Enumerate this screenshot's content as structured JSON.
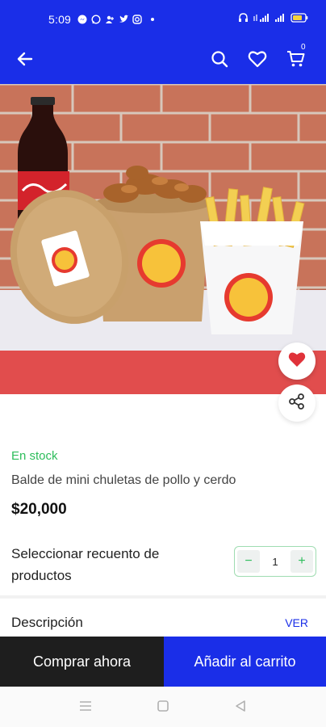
{
  "status_bar": {
    "time": "5:09",
    "icons_left": [
      "messenger-icon",
      "whatsapp-icon",
      "contacts-icon",
      "twitter-icon",
      "instagram-icon",
      "dot-icon"
    ],
    "icons_right": [
      "headset-icon",
      "signal-icon",
      "signal-icon",
      "battery-icon"
    ]
  },
  "app_bar": {
    "back_icon": "arrow-left-icon",
    "search_icon": "search-icon",
    "favorite_icon": "heart-outline-icon",
    "cart_icon": "cart-icon",
    "cart_count": "0"
  },
  "product": {
    "stock": "En stock",
    "name": "Balde de mini chuletas de pollo y cerdo",
    "price": "$20,000"
  },
  "quantity": {
    "label": "Seleccionar recuento de productos",
    "minus": "−",
    "value": "1",
    "plus": "+"
  },
  "description": {
    "title": "Descripción",
    "link": "VER"
  },
  "actions": {
    "buy_now": "Comprar ahora",
    "add_to_cart": "Añadir al carrito"
  },
  "colors": {
    "brand_blue": "#1a2ee8",
    "stock_green": "#2dbd5b",
    "buy_dark": "#1e1e1e",
    "heart_red": "#e0323a"
  }
}
